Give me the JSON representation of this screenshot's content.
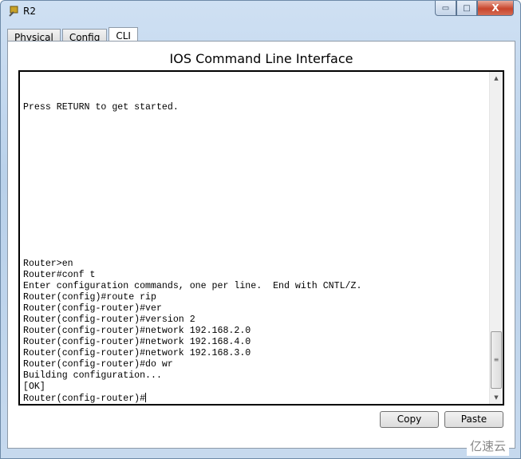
{
  "window": {
    "title": "R2",
    "minimize_glyph": "▭",
    "maximize_glyph": "□",
    "close_glyph": "X"
  },
  "tabs": [
    {
      "label": "Physical"
    },
    {
      "label": "Config"
    },
    {
      "label": "CLI",
      "active": true
    }
  ],
  "panel": {
    "heading": "IOS Command Line Interface"
  },
  "terminal": {
    "lines": [
      "",
      "",
      "Press RETURN to get started.",
      "",
      "",
      "",
      "",
      "",
      "",
      "",
      "",
      "",
      "",
      "",
      "",
      "",
      "Router>en",
      "Router#conf t",
      "Enter configuration commands, one per line.  End with CNTL/Z.",
      "Router(config)#route rip",
      "Router(config-router)#ver",
      "Router(config-router)#version 2",
      "Router(config-router)#network 192.168.2.0",
      "Router(config-router)#network 192.168.4.0",
      "Router(config-router)#network 192.168.3.0",
      "Router(config-router)#do wr",
      "Building configuration...",
      "[OK]"
    ],
    "prompt": "Router(config-router)#"
  },
  "buttons": {
    "copy": "Copy",
    "paste": "Paste"
  },
  "watermark": "亿速云"
}
